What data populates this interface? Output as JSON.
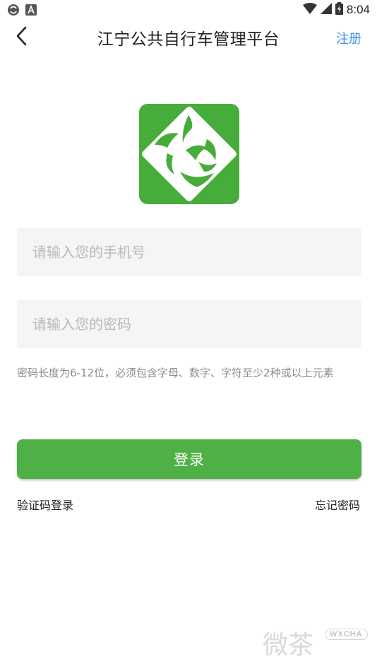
{
  "status_bar": {
    "time": "8:04",
    "icons": [
      "sync-icon",
      "a-notification-icon",
      "wifi-icon",
      "signal-icon",
      "battery-icon"
    ]
  },
  "app_bar": {
    "title": "江宁公共自行车管理平台",
    "back_icon": "back-arrow-icon",
    "register_label": "注册"
  },
  "logo": {
    "icon": "bike-app-logo",
    "color": "#47ad3a"
  },
  "form": {
    "phone_placeholder": "请输入您的手机号",
    "password_placeholder": "请输入您的密码",
    "phone_value": "",
    "password_value": "",
    "password_hint": "密码长度为6-12位，必须包含字母、数字、字符至少2种或以上元素"
  },
  "login_button_label": "登录",
  "links": {
    "sms_login": "验证码登录",
    "forgot_password": "忘记密码"
  },
  "watermark": {
    "text": "微茶",
    "badge": "WXCHA"
  },
  "colors": {
    "accent": "#4fb046",
    "link": "#3d8fe6",
    "input_bg": "#f5f5f5"
  }
}
